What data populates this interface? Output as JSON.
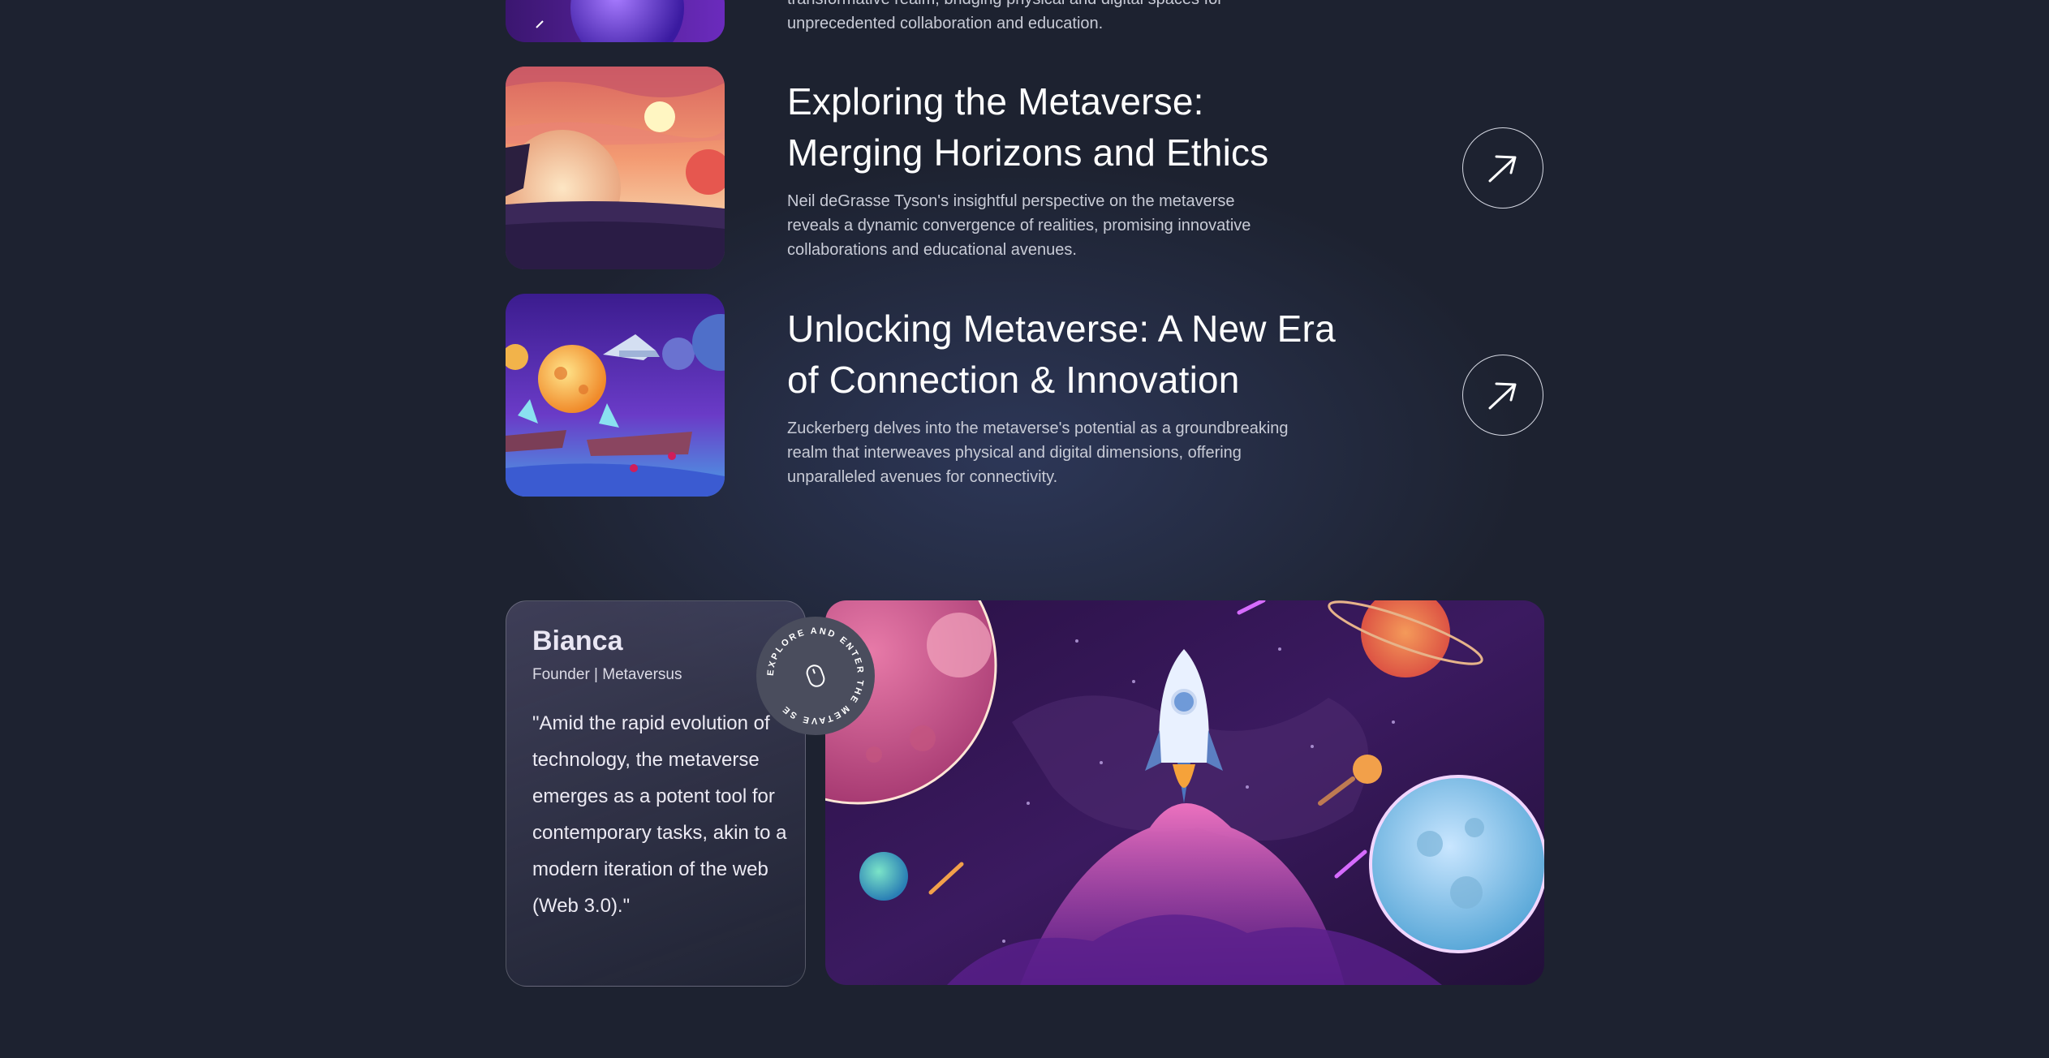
{
  "articles": [
    {
      "description_partial": "transformative realm, bridging physical and digital spaces for",
      "description_end": "unprecedented collaboration and education."
    },
    {
      "title_line1": "Exploring the Metaverse:",
      "title_line2": "Merging Horizons and Ethics",
      "description": "Neil deGrasse Tyson's insightful perspective on the metaverse reveals a dynamic convergence of realities, promising innovative collaborations and educational avenues.",
      "thumbnail_icon": "sunset-planet-image",
      "link_icon": "arrow-up-right-icon"
    },
    {
      "title_line1": "Unlocking Metaverse: A New Era",
      "title_line2": "of Connection & Innovation",
      "description": "Zuckerberg delves into the metaverse's potential as a groundbreaking realm that interweaves physical and digital dimensions, offering unparalleled avenues for connectivity.",
      "thumbnail_icon": "space-islands-image",
      "link_icon": "arrow-up-right-icon"
    }
  ],
  "testimonial": {
    "name": "Bianca",
    "role": "Founder | Metaversus",
    "quote": "\"Amid the rapid evolution of technology, the metaverse emerges as a potent tool for contemporary tasks, akin to a modern iteration of the web (Web 3.0).\""
  },
  "badge": {
    "circular_text": "EXPLORE AND ENTER THE METAVE SE",
    "icon": "mouse-icon"
  },
  "hero_image": {
    "icon": "rocket-space-illustration"
  },
  "colors": {
    "background": "#1d2230",
    "text_primary": "#ffffff",
    "text_secondary": "#c8cbd6"
  }
}
